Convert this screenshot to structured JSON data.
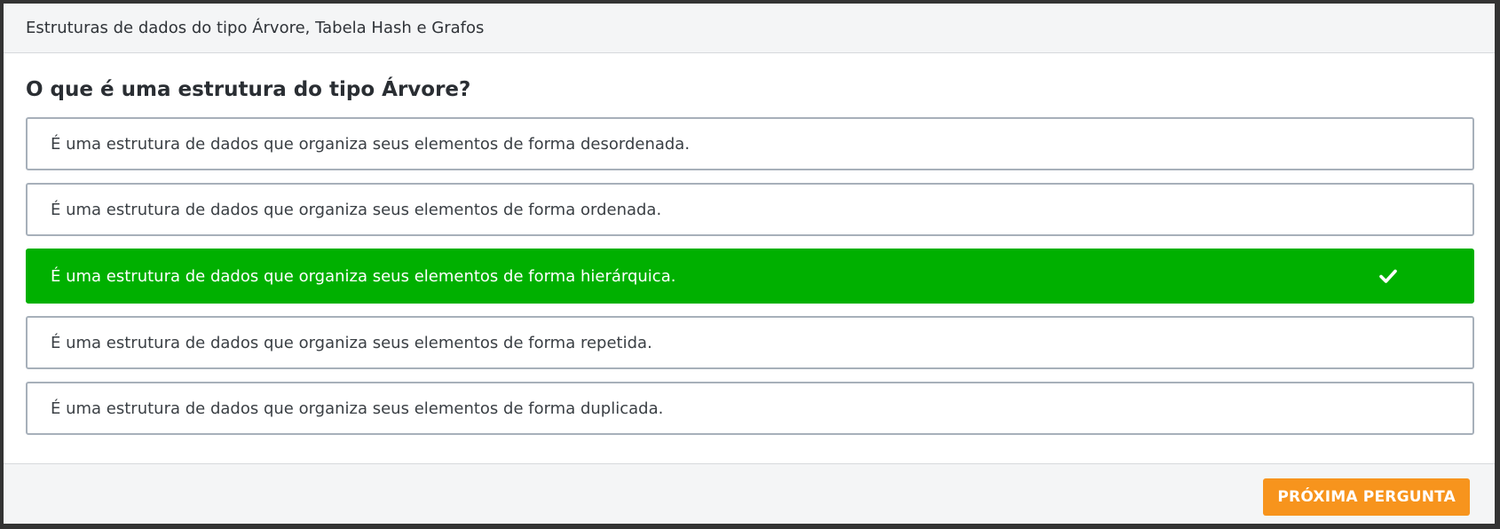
{
  "header": {
    "title": "Estruturas de dados do tipo Árvore, Tabela Hash e Grafos"
  },
  "question": {
    "text": "O que é uma estrutura do tipo Árvore?"
  },
  "options": [
    {
      "label": "É uma estrutura de dados que organiza seus elementos de forma desordenada.",
      "selected": false
    },
    {
      "label": "É uma estrutura de dados que organiza seus elementos de forma ordenada.",
      "selected": false
    },
    {
      "label": "É uma estrutura de dados que organiza seus elementos de forma hierárquica.",
      "selected": true
    },
    {
      "label": "É uma estrutura de dados que organiza seus elementos de forma repetida.",
      "selected": false
    },
    {
      "label": "É uma estrutura de dados que organiza seus elementos de forma duplicada.",
      "selected": false
    }
  ],
  "footer": {
    "next_label": "PRÓXIMA PERGUNTA"
  },
  "colors": {
    "selected_green": "#00b000",
    "next_orange": "#f7941d",
    "option_border": "#a7b0ba"
  },
  "icons": {
    "selected_mark": "check-icon"
  }
}
